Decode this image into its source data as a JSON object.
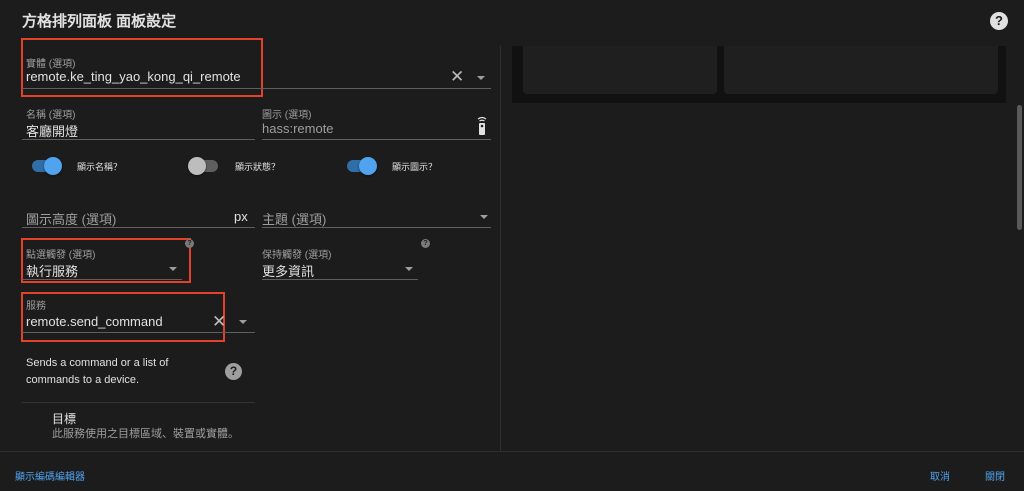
{
  "dialog": {
    "title": "方格排列面板 面板設定",
    "help_glyph": "?"
  },
  "form": {
    "entity": {
      "label": "實體 (選項)",
      "value": "remote.ke_ting_yao_kong_qi_remote"
    },
    "name": {
      "label": "名稱 (選項)",
      "value": "客廳開燈"
    },
    "icon": {
      "label": "圖示 (選項)",
      "placeholder": "hass:remote"
    },
    "toggles": [
      {
        "label": "顯示名稱？",
        "on": true
      },
      {
        "label": "顯示狀態？",
        "on": false
      },
      {
        "label": "顯示圖示？",
        "on": true
      }
    ],
    "icon_height": {
      "placeholder": "圖示高度 (選項)",
      "suffix": "px"
    },
    "theme": {
      "placeholder": "主題 (選項)"
    },
    "tap_action": {
      "label": "點選觸發 (選項)",
      "value": "執行服務"
    },
    "hold_action": {
      "label": "保持觸發 (選項)",
      "value": "更多資訊"
    },
    "service": {
      "label": "服務",
      "value": "remote.send_command"
    },
    "service_description": "Sends a command or a list of commands to a device.",
    "target": {
      "title": "目標",
      "description": "此服務使用之目標區域、裝置或實體。"
    }
  },
  "footer": {
    "show_code_editor": "顯示編碼編輯器",
    "cancel": "取消",
    "close": "關閉"
  },
  "colors": {
    "accent": "#4fa3ef",
    "highlight_box": "#e3412a",
    "background": "#1c1c1c"
  }
}
